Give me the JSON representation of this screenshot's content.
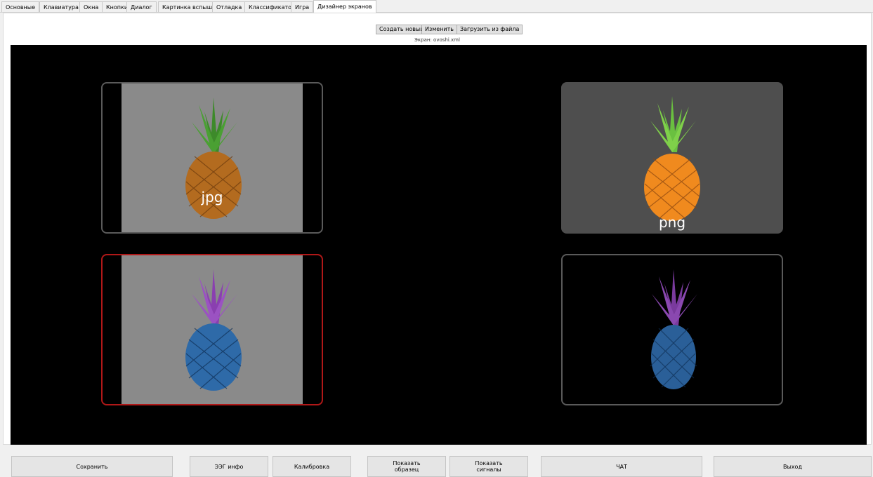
{
  "tabs": [
    "Основные",
    "Клавиатура",
    "Окна",
    "Кнопки",
    "Диалог",
    "Картинка вспышки",
    "Отладка",
    "Классификатор",
    "Игра",
    "Дизайнер экранов"
  ],
  "active_tab": "Дизайнер экранов",
  "toolbar": {
    "create_label": "Создать новый",
    "edit_label": "Изменить",
    "load_label": "Загрузить из файла",
    "screen_caption": "Экран: ovoshi.xml"
  },
  "tiles": [
    {
      "label": "jpg",
      "pineapple_color": "orange",
      "border_color": "#5a5a5a"
    },
    {
      "label": "png",
      "pineapple_color": "orange",
      "border_color": "#5a5a5a"
    },
    {
      "label": "",
      "pineapple_color": "blue-purple",
      "border_color": "#b01818"
    },
    {
      "label": "",
      "pineapple_color": "blue-purple",
      "border_color": "#5a5a5a"
    }
  ],
  "bottom_buttons": {
    "save": "Сохранить",
    "eeg_info": "ЭЭГ инфо",
    "calibration": "Калибровка",
    "show_sample": "Показать\nобразец",
    "show_signals": "Показать\nсигналы",
    "chat": "ЧАТ",
    "exit": "Выход"
  },
  "colors": {
    "canvas_bg": "#000000",
    "selected_border": "#b01818",
    "tile_gray": "#8a8a8a"
  }
}
